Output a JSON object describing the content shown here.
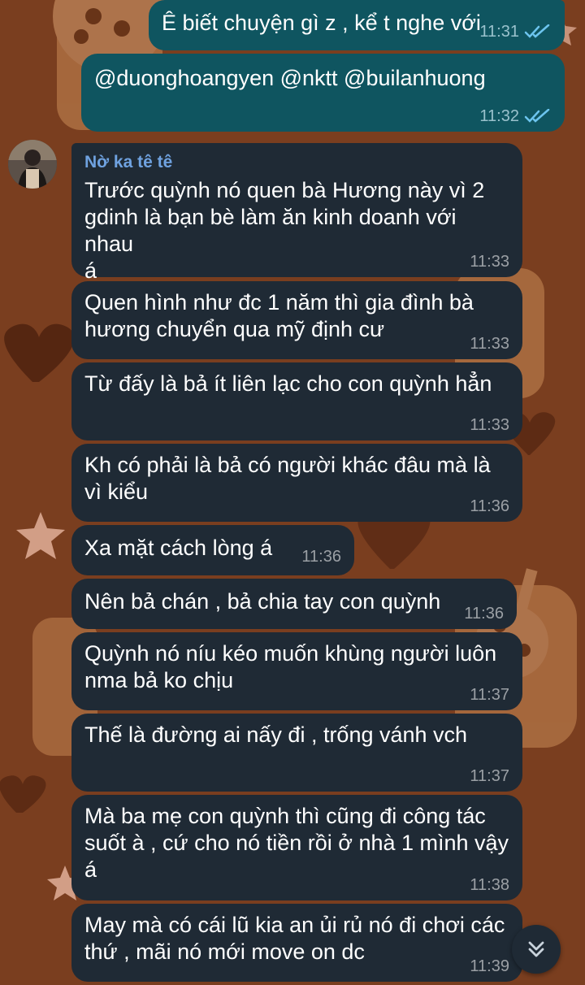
{
  "theme": {
    "wallpaper_color": "#7a3e1f",
    "outgoing_bubble_color": "#0f5560",
    "incoming_bubble_color": "#1f2a35",
    "sender_name_color": "#6fa2e0",
    "read_check_color": "#6cc4ee"
  },
  "messages": [
    {
      "direction": "out",
      "text": "Ê biết chuyện gì z , kể t nghe với",
      "time": "11:31",
      "status": "read"
    },
    {
      "direction": "out",
      "text": "@duonghoangyen @nktt @builanhuong",
      "time": "11:32",
      "status": "read"
    },
    {
      "direction": "in",
      "sender": "Nờ ka tê tê",
      "text": "Trước quỳnh nó quen bà Hương này vì 2\ngdinh là bạn bè làm ăn kinh doanh với nhau\ná",
      "time": "11:33"
    },
    {
      "direction": "in",
      "text": "Quen hình như đc 1 năm thì gia đình bà\nhương chuyển qua mỹ định cư",
      "time": "11:33"
    },
    {
      "direction": "in",
      "text": "Từ đấy là bả ít liên lạc cho con quỳnh hẳn",
      "time": "11:33"
    },
    {
      "direction": "in",
      "text": "Kh có phải là bả có người khác đâu mà là\nvì kiểu",
      "time": "11:36"
    },
    {
      "direction": "in",
      "text": "Xa mặt cách lòng á",
      "time": "11:36"
    },
    {
      "direction": "in",
      "text": "Nên bả chán , bả chia tay con quỳnh",
      "time": "11:36"
    },
    {
      "direction": "in",
      "text": "Quỳnh nó níu kéo muốn khùng người luôn\nnma bả ko chịu",
      "time": "11:37"
    },
    {
      "direction": "in",
      "text": "Thế là đường ai nấy đi , trống vánh vch",
      "time": "11:37"
    },
    {
      "direction": "in",
      "text": "Mà ba mẹ con quỳnh thì cũng đi công tác\nsuốt à , cứ cho nó tiền rồi ở nhà 1 mình vậy\ná",
      "time": "11:38"
    },
    {
      "direction": "in",
      "text": "May mà có cái lũ kia an ủi rủ nó đi chơi các\nthứ , mãi nó mới move on dc",
      "time": "11:39"
    }
  ],
  "icons": {
    "avatar": "avatar",
    "read_status": "double-check-icon",
    "scroll_down": "double-chevron-down-icon"
  }
}
